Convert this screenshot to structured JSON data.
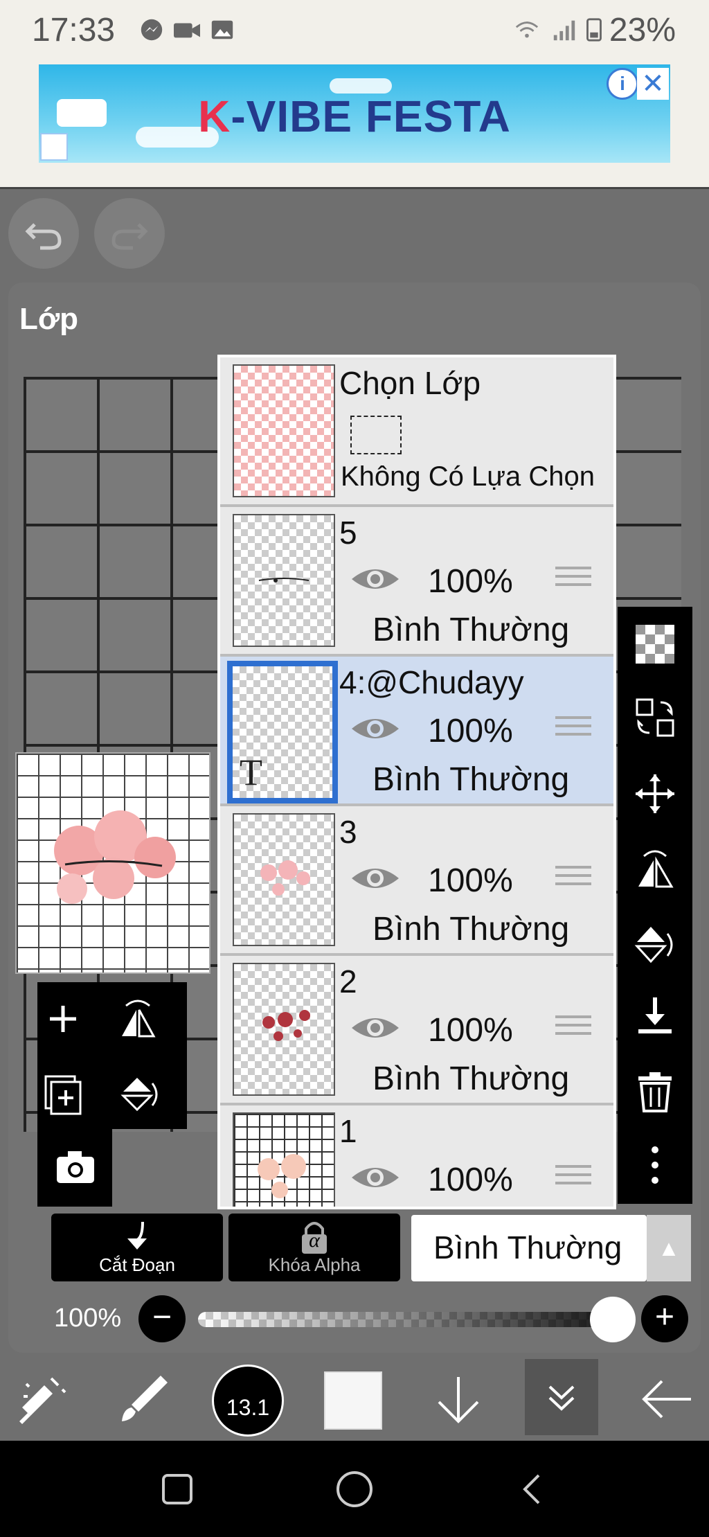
{
  "status_bar": {
    "time": "17:33",
    "battery": "23%"
  },
  "ad": {
    "title_k": "K",
    "title_rest": "-VIBE FESTA",
    "info": "i",
    "close": "✕"
  },
  "panel": {
    "title": "Lớp"
  },
  "layers": {
    "selection": {
      "title": "Chọn Lớp",
      "subtitle": "Không Có Lựa Chọn"
    },
    "items": [
      {
        "name": "5",
        "opacity": "100%",
        "mode": "Bình Thường"
      },
      {
        "name": "4:@Chudayy",
        "opacity": "100%",
        "mode": "Bình Thường",
        "thumb_text": "T"
      },
      {
        "name": "3",
        "opacity": "100%",
        "mode": "Bình Thường"
      },
      {
        "name": "2",
        "opacity": "100%",
        "mode": "Bình Thường"
      },
      {
        "name": "1",
        "opacity": "100%"
      }
    ]
  },
  "controls": {
    "clip_label": "Cắt Đoạn",
    "alpha_label": "Khóa Alpha",
    "alpha_glyph": "α",
    "blend_mode": "Bình Thường",
    "opacity": "100%",
    "minus": "−",
    "plus": "+"
  },
  "bottom": {
    "brush_size": "13.1"
  },
  "colors": {
    "selected_layer_bg": "#cfdcf0",
    "selected_border": "#2e6fd0",
    "panel_bg": "#737373"
  }
}
